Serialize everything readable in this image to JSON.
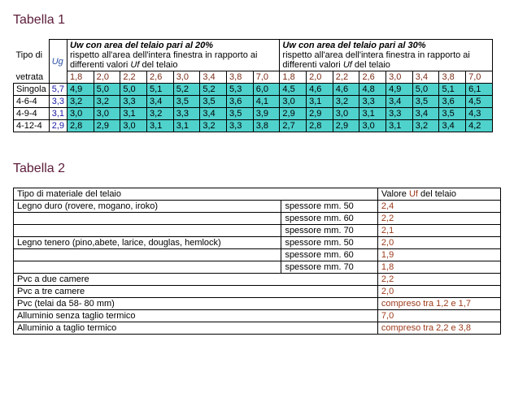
{
  "t1": {
    "title": "Tabella 1",
    "rh1": "Tipo di",
    "rh2": "vetrata",
    "ug": "Ug",
    "hdr20_a": "Uw",
    "hdr20_b": " con area del telaio pari al 20%",
    "hdr20_c": "rispetto all'area dell'intera finestra in rapporto ai differenti valori ",
    "hdr20_d": "Uf",
    "hdr20_e": " del telaio",
    "hdr30_a": "Uw",
    "hdr30_b": " con area del telaio pari al 30%",
    "hdr30_c": "rispetto all'area dell'intera finestra in rapporto ai differenti valori ",
    "hdr30_d": "Uf",
    "hdr30_e": " del telaio",
    "uf": [
      "1,8",
      "2,0",
      "2,2",
      "2,6",
      "3,0",
      "3,4",
      "3,8",
      "7,0",
      "1,8",
      "2,0",
      "2,2",
      "2,6",
      "3,0",
      "3,4",
      "3,8",
      "7,0"
    ],
    "rows": [
      {
        "n": "Singola",
        "ug": "5,7",
        "v": [
          "4,9",
          "5,0",
          "5,0",
          "5,1",
          "5,2",
          "5,2",
          "5,3",
          "6,0",
          "4,5",
          "4,6",
          "4,6",
          "4,8",
          "4,9",
          "5,0",
          "5,1",
          "6,1"
        ]
      },
      {
        "n": "4-6-4",
        "ug": "3,3",
        "v": [
          "3,2",
          "3,2",
          "3,3",
          "3,4",
          "3,5",
          "3,5",
          "3,6",
          "4,1",
          "3,0",
          "3,1",
          "3,2",
          "3,3",
          "3,4",
          "3,5",
          "3,6",
          "4,5"
        ]
      },
      {
        "n": "4-9-4",
        "ug": "3,1",
        "v": [
          "3,0",
          "3,0",
          "3,1",
          "3,2",
          "3,3",
          "3,4",
          "3,5",
          "3,9",
          "2,9",
          "2,9",
          "3,0",
          "3,1",
          "3,3",
          "3,4",
          "3,5",
          "4,3"
        ]
      },
      {
        "n": "4-12-4",
        "ug": "2,9",
        "v": [
          "2,8",
          "2,9",
          "3,0",
          "3,1",
          "3,1",
          "3,2",
          "3,3",
          "3,8",
          "2,7",
          "2,8",
          "2,9",
          "3,0",
          "3,1",
          "3,2",
          "3,4",
          "4,2"
        ]
      }
    ]
  },
  "t2": {
    "title": "Tabella 2",
    "h1": "Tipo di materiale del telaio",
    "h2a": "Valore ",
    "h2b": "Uf",
    "h2c": " del telaio",
    "rows": [
      [
        "Legno duro (rovere, mogano, iroko)",
        "spessore mm. 50",
        "2,4"
      ],
      [
        "",
        "spessore mm. 60",
        "2,2"
      ],
      [
        "",
        "spessore mm. 70",
        "2,1"
      ],
      [
        "Legno tenero (pino,abete, larice, douglas, hemlock)",
        "spessore mm. 50",
        "2,0"
      ],
      [
        "",
        "spessore mm. 60",
        "1,9"
      ],
      [
        "",
        "spessore mm. 70",
        "1,8"
      ],
      [
        "Pvc a due camere",
        "",
        "2,2"
      ],
      [
        "Pvc a tre camere",
        "",
        "2,0"
      ],
      [
        "Pvc (telai da 58- 80 mm)",
        "",
        "compreso tra 1,2 e 1,7"
      ],
      [
        "Alluminio senza taglio termico",
        "",
        "7,0"
      ],
      [
        "Alluminio a taglio termico",
        "",
        "compreso tra 2,2 e 3,8"
      ]
    ]
  },
  "chart_data": [
    {
      "type": "table",
      "title": "Tabella 1 — Uw per area telaio 20% e 30% al variare di Uf",
      "row_labels": [
        "Singola",
        "4-6-4",
        "4-9-4",
        "4-12-4"
      ],
      "Ug": [
        5.7,
        3.3,
        3.1,
        2.9
      ],
      "Uf_columns": [
        1.8,
        2.0,
        2.2,
        2.6,
        3.0,
        3.4,
        3.8,
        7.0
      ],
      "Uw_area_20pct": [
        [
          4.9,
          5.0,
          5.0,
          5.1,
          5.2,
          5.2,
          5.3,
          6.0
        ],
        [
          3.2,
          3.2,
          3.3,
          3.4,
          3.5,
          3.5,
          3.6,
          4.1
        ],
        [
          3.0,
          3.0,
          3.1,
          3.2,
          3.3,
          3.4,
          3.5,
          3.9
        ],
        [
          2.8,
          2.9,
          3.0,
          3.1,
          3.1,
          3.2,
          3.3,
          3.8
        ]
      ],
      "Uw_area_30pct": [
        [
          4.5,
          4.6,
          4.6,
          4.8,
          4.9,
          5.0,
          5.1,
          6.1
        ],
        [
          3.0,
          3.1,
          3.2,
          3.3,
          3.4,
          3.5,
          3.6,
          4.5
        ],
        [
          2.9,
          2.9,
          3.0,
          3.1,
          3.3,
          3.4,
          3.5,
          4.3
        ],
        [
          2.7,
          2.8,
          2.9,
          3.0,
          3.1,
          3.2,
          3.4,
          4.2
        ]
      ]
    },
    {
      "type": "table",
      "title": "Tabella 2 — Valore Uf del telaio per materiale",
      "rows": [
        {
          "materiale": "Legno duro (rovere, mogano, iroko)",
          "spessore": "mm. 50",
          "Uf": "2,4"
        },
        {
          "materiale": "Legno duro (rovere, mogano, iroko)",
          "spessore": "mm. 60",
          "Uf": "2,2"
        },
        {
          "materiale": "Legno duro (rovere, mogano, iroko)",
          "spessore": "mm. 70",
          "Uf": "2,1"
        },
        {
          "materiale": "Legno tenero (pino,abete, larice, douglas, hemlock)",
          "spessore": "mm. 50",
          "Uf": "2,0"
        },
        {
          "materiale": "Legno tenero (pino,abete, larice, douglas, hemlock)",
          "spessore": "mm. 60",
          "Uf": "1,9"
        },
        {
          "materiale": "Legno tenero (pino,abete, larice, douglas, hemlock)",
          "spessore": "mm. 70",
          "Uf": "1,8"
        },
        {
          "materiale": "Pvc a due camere",
          "spessore": "",
          "Uf": "2,2"
        },
        {
          "materiale": "Pvc a tre camere",
          "spessore": "",
          "Uf": "2,0"
        },
        {
          "materiale": "Pvc (telai da 58- 80 mm)",
          "spessore": "",
          "Uf": "compreso tra 1,2 e 1,7"
        },
        {
          "materiale": "Alluminio senza taglio termico",
          "spessore": "",
          "Uf": "7,0"
        },
        {
          "materiale": "Alluminio a taglio termico",
          "spessore": "",
          "Uf": "compreso tra 2,2 e 3,8"
        }
      ]
    }
  ]
}
